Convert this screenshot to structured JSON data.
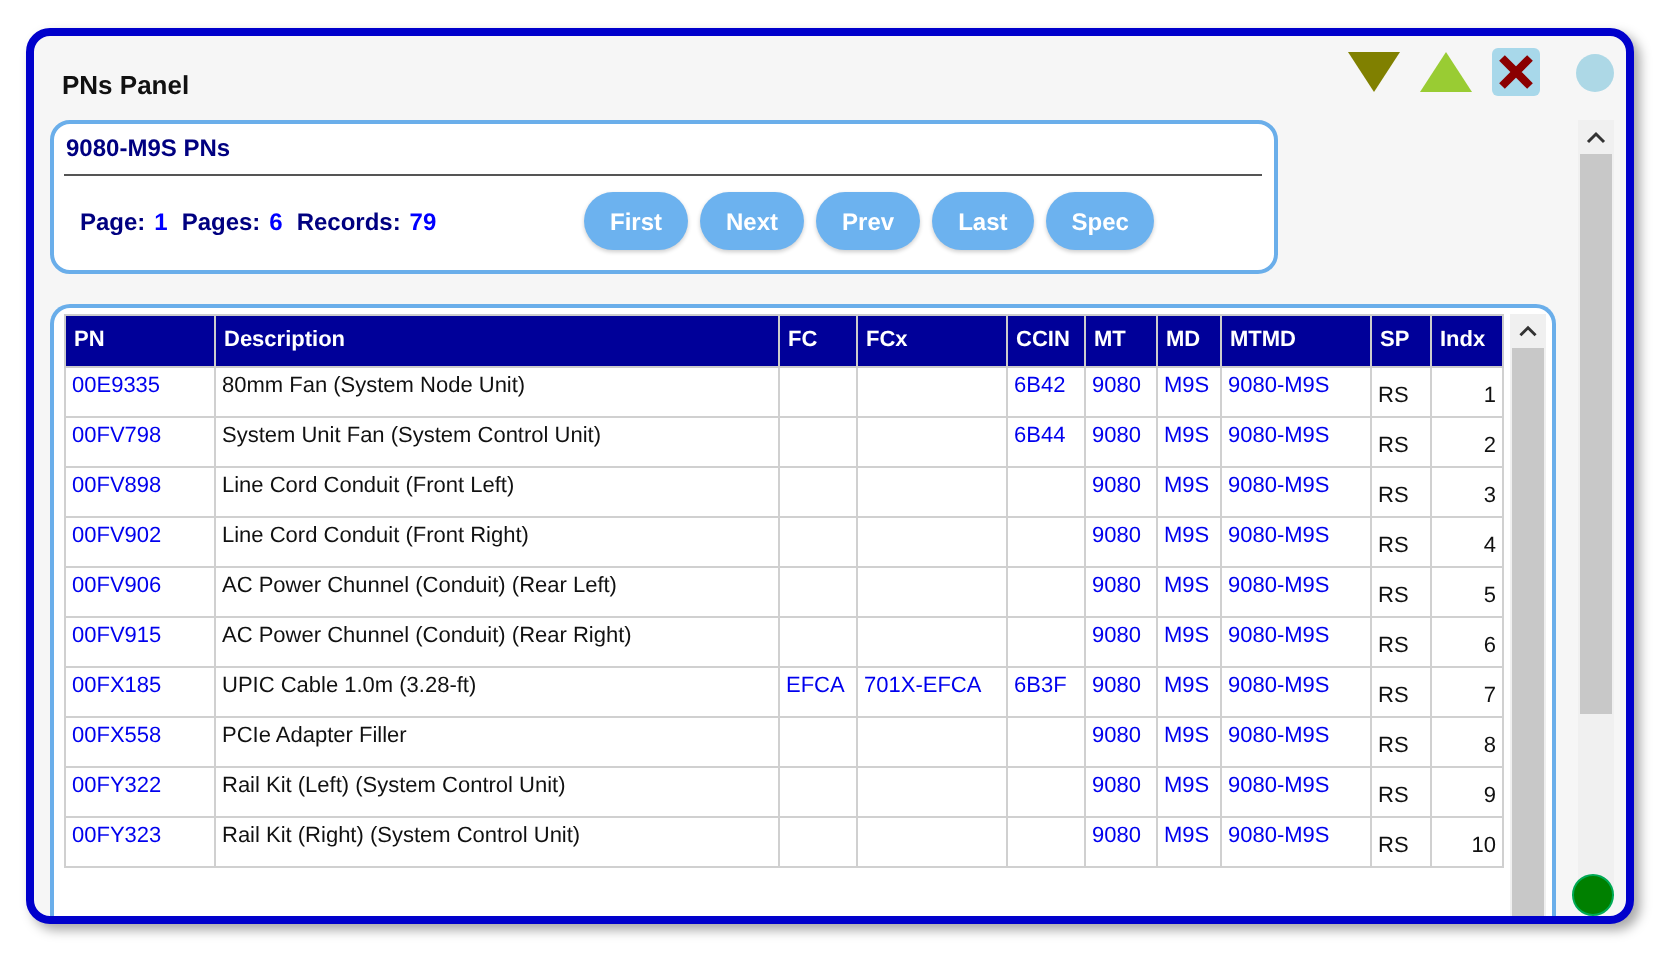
{
  "window": {
    "title": "PNs Panel"
  },
  "info": {
    "title": "9080-M9S PNs",
    "page_label": "Page:",
    "page": "1",
    "pages_label": "Pages:",
    "pages": "6",
    "records_label": "Records:",
    "records": "79"
  },
  "buttons": [
    "First",
    "Next",
    "Prev",
    "Last",
    "Spec"
  ],
  "table": {
    "columns": [
      "PN",
      "Description",
      "FC",
      "FCx",
      "CCIN",
      "MT",
      "MD",
      "MTMD",
      "SP",
      "Indx"
    ],
    "rows": [
      {
        "pn": "00E9335",
        "description": "80mm Fan (System Node Unit)",
        "ccin": "6B42",
        "mt": "9080",
        "md": "M9S",
        "mtmd": "9080-M9S",
        "sp": "RS",
        "indx": "1"
      },
      {
        "pn": "00FV798",
        "description": "System Unit Fan (System Control Unit)",
        "ccin": "6B44",
        "mt": "9080",
        "md": "M9S",
        "mtmd": "9080-M9S",
        "sp": "RS",
        "indx": "2"
      },
      {
        "pn": "00FV898",
        "description": "Line Cord Conduit (Front Left)",
        "mt": "9080",
        "md": "M9S",
        "mtmd": "9080-M9S",
        "sp": "RS",
        "indx": "3"
      },
      {
        "pn": "00FV902",
        "description": "Line Cord Conduit (Front Right)",
        "mt": "9080",
        "md": "M9S",
        "mtmd": "9080-M9S",
        "sp": "RS",
        "indx": "4"
      },
      {
        "pn": "00FV906",
        "description": "AC Power Chunnel (Conduit) (Rear Left)",
        "mt": "9080",
        "md": "M9S",
        "mtmd": "9080-M9S",
        "sp": "RS",
        "indx": "5"
      },
      {
        "pn": "00FV915",
        "description": "AC Power Chunnel (Conduit) (Rear Right)",
        "mt": "9080",
        "md": "M9S",
        "mtmd": "9080-M9S",
        "sp": "RS",
        "indx": "6"
      },
      {
        "pn": "00FX185",
        "description": "UPIC Cable 1.0m (3.28-ft)",
        "fc": "EFCA",
        "fcx": "701X-EFCA",
        "ccin": "6B3F",
        "mt": "9080",
        "md": "M9S",
        "mtmd": "9080-M9S",
        "sp": "RS",
        "indx": "7"
      },
      {
        "pn": "00FX558",
        "description": "PCIe Adapter Filler",
        "mt": "9080",
        "md": "M9S",
        "mtmd": "9080-M9S",
        "sp": "RS",
        "indx": "8"
      },
      {
        "pn": "00FY322",
        "description": "Rail Kit (Left) (System Control Unit)",
        "mt": "9080",
        "md": "M9S",
        "mtmd": "9080-M9S",
        "sp": "RS",
        "indx": "9"
      },
      {
        "pn": "00FY323",
        "description": "Rail Kit (Right) (System Control Unit)",
        "mt": "9080",
        "md": "M9S",
        "mtmd": "9080-M9S",
        "sp": "RS",
        "indx": "10"
      }
    ]
  }
}
